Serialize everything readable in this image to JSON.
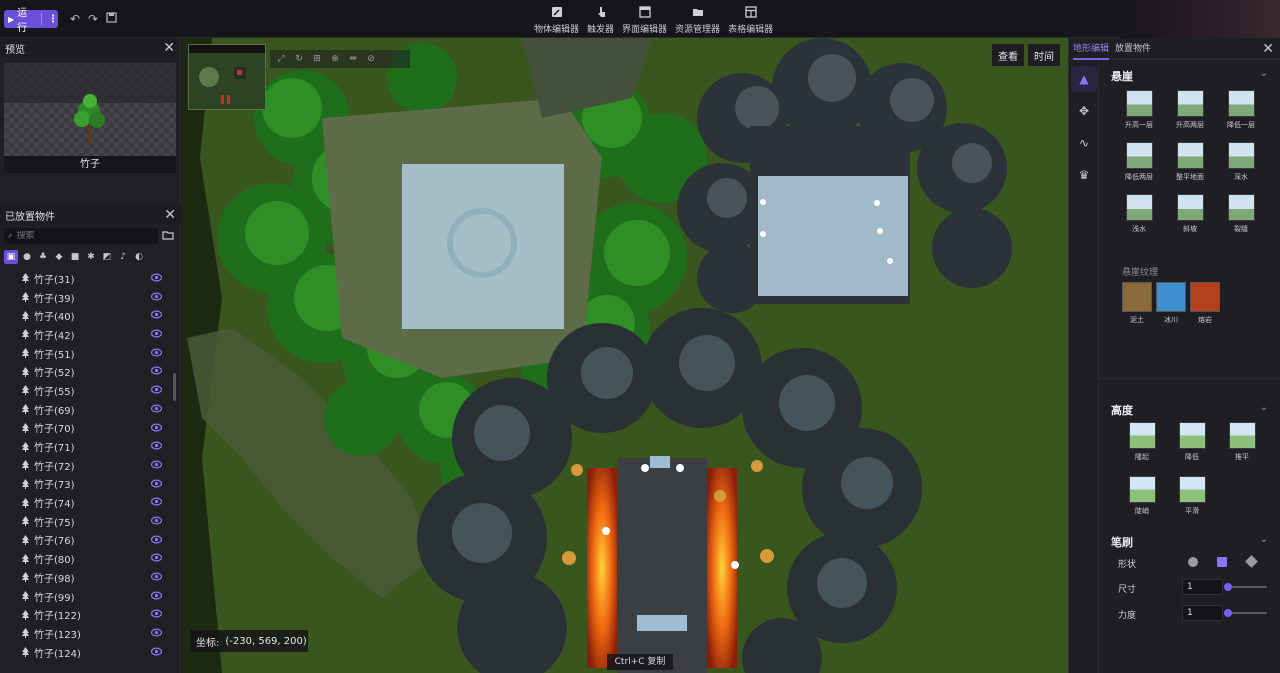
{
  "toolbar": {
    "run_label": "运行",
    "editors": [
      {
        "label": "物体编辑器",
        "icon": "edit-icon"
      },
      {
        "label": "触发器",
        "icon": "hand-pointer-icon"
      },
      {
        "label": "界面编辑器",
        "icon": "window-icon"
      },
      {
        "label": "资源管理器",
        "icon": "folder-icon"
      },
      {
        "label": "表格编辑器",
        "icon": "table-icon"
      }
    ]
  },
  "preview": {
    "title": "预览",
    "object_name": "竹子"
  },
  "placed": {
    "title": "已放置物件",
    "search_placeholder": "搜索",
    "items": [
      "竹子(31)",
      "竹子(39)",
      "竹子(40)",
      "竹子(42)",
      "竹子(51)",
      "竹子(52)",
      "竹子(55)",
      "竹子(69)",
      "竹子(70)",
      "竹子(71)",
      "竹子(72)",
      "竹子(73)",
      "竹子(74)",
      "竹子(75)",
      "竹子(76)",
      "竹子(80)",
      "竹子(98)",
      "竹子(99)",
      "竹子(122)",
      "竹子(123)",
      "竹子(124)"
    ]
  },
  "viewport": {
    "view_label": "查看",
    "time_label": "时间",
    "coord_label": "坐标:",
    "coord_value": "(-230, 569, 200)",
    "copy_hint": "Ctrl+C 复制"
  },
  "right": {
    "tabs": [
      "地形编辑",
      "放置物件"
    ],
    "cliff_title": "悬崖",
    "cliff_tools": [
      "升高一层",
      "升高两层",
      "降低一层",
      "降低两层",
      "整平地面",
      "深水",
      "浅水",
      "斜坡",
      "裂缝"
    ],
    "texture_title": "悬崖纹理",
    "textures": [
      {
        "label": "泥土",
        "color": "#8a6a3a"
      },
      {
        "label": "冰川",
        "color": "#3f8fd0"
      },
      {
        "label": "熔岩",
        "color": "#b5401e"
      }
    ],
    "height_title": "高度",
    "height_tools": [
      "隆起",
      "降低",
      "推平",
      "陡峭",
      "平滑"
    ],
    "brush_title": "笔刷",
    "shape_label": "形状",
    "size_label": "尺寸",
    "size_value": "1",
    "strength_label": "力度",
    "strength_value": "1"
  },
  "colors": {
    "accent": "#6a4fd8",
    "eye": "#8f74ff"
  }
}
